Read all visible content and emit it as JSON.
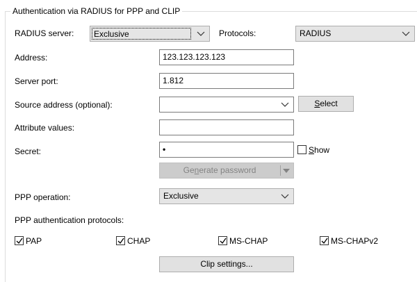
{
  "group": {
    "title": "Authentication via RADIUS for PPP and CLIP"
  },
  "radius_server": {
    "label": "RADIUS server:",
    "value": "Exclusive"
  },
  "protocols": {
    "label": "Protocols:",
    "value": "RADIUS"
  },
  "address": {
    "label": "Address:",
    "value": "123.123.123.123"
  },
  "server_port": {
    "label": "Server port:",
    "value": "1.812"
  },
  "source_address": {
    "label": "Source address (optional):",
    "value": "",
    "button_pre": "",
    "button_u": "S",
    "button_post": "elect"
  },
  "attribute_values": {
    "label": "Attribute values:",
    "value": ""
  },
  "secret": {
    "label": "Secret:",
    "value": "•",
    "show_pre": "",
    "show_u": "S",
    "show_post": "how"
  },
  "generate": {
    "pre": "Ge",
    "u": "n",
    "post": "erate password"
  },
  "ppp_operation": {
    "label": "PPP operation:",
    "value": "Exclusive"
  },
  "ppp_auth": {
    "label": "PPP authentication protocols:",
    "options": [
      {
        "label": "PAP",
        "checked": true
      },
      {
        "label": "CHAP",
        "checked": true
      },
      {
        "label": "MS-CHAP",
        "checked": true
      },
      {
        "label": "MS-CHAPv2",
        "checked": true
      }
    ]
  },
  "clip_settings": {
    "label": "Clip settings..."
  }
}
